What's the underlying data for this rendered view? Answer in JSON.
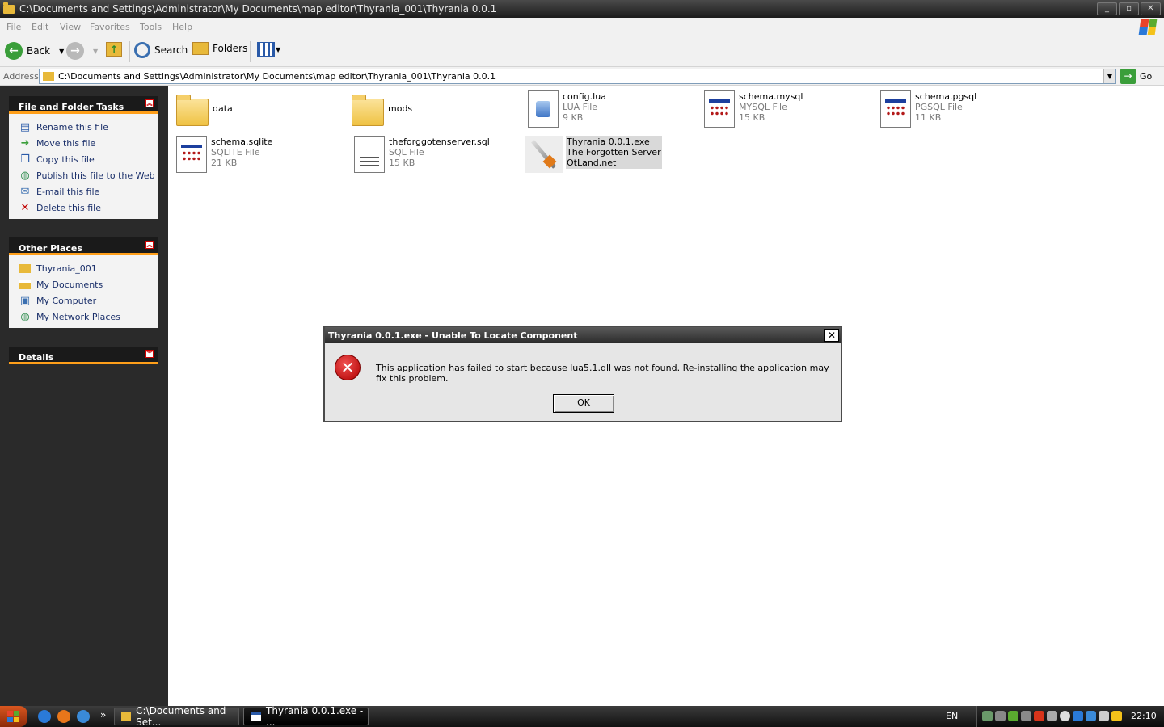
{
  "window": {
    "title": "C:\\Documents and Settings\\Administrator\\My Documents\\map editor\\Thyrania_001\\Thyrania 0.0.1",
    "buttons": {
      "minimize": "_",
      "maximize": "▫",
      "close": "✕"
    }
  },
  "menu": [
    "File",
    "Edit",
    "View",
    "Favorites",
    "Tools",
    "Help"
  ],
  "toolbar": {
    "back": "Back",
    "search": "Search",
    "folders": "Folders"
  },
  "address": {
    "label": "Address",
    "value": "C:\\Documents and Settings\\Administrator\\My Documents\\map editor\\Thyrania_001\\Thyrania 0.0.1",
    "go": "Go"
  },
  "sidebar": {
    "file_tasks": {
      "title": "File and Folder Tasks",
      "items": [
        "Rename this file",
        "Move this file",
        "Copy this file",
        "Publish this file to the Web",
        "E-mail this file",
        "Delete this file"
      ]
    },
    "other_places": {
      "title": "Other Places",
      "items": [
        "Thyrania_001",
        "My Documents",
        "My Computer",
        "My Network Places"
      ]
    },
    "details": {
      "title": "Details"
    }
  },
  "files": [
    {
      "name": "data",
      "type": "",
      "size": "",
      "icon": "folder-icon"
    },
    {
      "name": "mods",
      "type": "",
      "size": "",
      "icon": "folder-icon"
    },
    {
      "name": "config.lua",
      "type": "LUA File",
      "size": "9 KB",
      "icon": "lua-file-icon"
    },
    {
      "name": "schema.mysql",
      "type": "MYSQL File",
      "size": "15 KB",
      "icon": "generic-file-icon"
    },
    {
      "name": "schema.pgsql",
      "type": "PGSQL File",
      "size": "11 KB",
      "icon": "generic-file-icon"
    },
    {
      "name": "schema.sqlite",
      "type": "SQLITE File",
      "size": "21 KB",
      "icon": "generic-file-icon"
    },
    {
      "name": "theforggotenserver.sql",
      "type": "SQL File",
      "size": "15 KB",
      "icon": "text-file-icon"
    },
    {
      "name": "Thyrania 0.0.1.exe",
      "type": "The Forgotten Server",
      "size": "OtLand.net",
      "icon": "exe-icon"
    }
  ],
  "dialog": {
    "title": "Thyrania 0.0.1.exe - Unable To Locate Component",
    "message": "This application has failed to start because lua5.1.dll was not found. Re-installing the application may fix this problem.",
    "ok": "OK",
    "close": "✕"
  },
  "taskbar": {
    "tasks": [
      "C:\\Documents and Set...",
      "Thyrania 0.0.1.exe - ..."
    ],
    "lang": "EN",
    "clock": "22:10",
    "more": "»"
  },
  "colors": {
    "sidebar_bg": "#2a2a2a",
    "panel_accent": "#ff9f1a",
    "link": "#1a2f6a",
    "error_red": "#b00000"
  }
}
